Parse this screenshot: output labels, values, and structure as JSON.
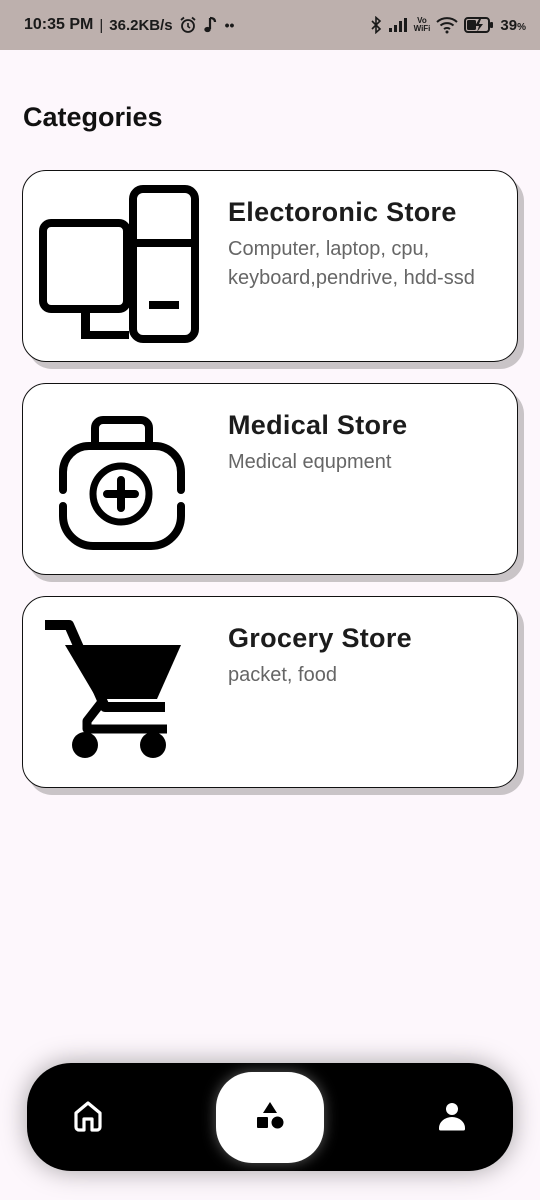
{
  "status_bar": {
    "time": "10:35 PM",
    "separator": "|",
    "network_speed": "36.2KB/s",
    "dots": "••",
    "volte_top": "Vo",
    "volte_bottom": "WiFi",
    "battery": "39",
    "battery_unit": "%",
    "icons": [
      "alarm-icon",
      "music-note-icon",
      "bluetooth-icon",
      "signal-icon",
      "wifi-icon",
      "battery-charging-icon"
    ]
  },
  "page": {
    "title": "Categories"
  },
  "categories": [
    {
      "icon": "computer-icon",
      "title": "Electoronic Store",
      "description": "Computer, laptop, cpu, keyboard,pendrive, hdd-ssd"
    },
    {
      "icon": "medical-kit-icon",
      "title": "Medical Store",
      "description": "Medical equpment"
    },
    {
      "icon": "shopping-cart-icon",
      "title": "Grocery Store",
      "description": "packet, food"
    }
  ],
  "bottom_nav": {
    "items": [
      {
        "icon": "home-icon",
        "active": false
      },
      {
        "icon": "shapes-icon",
        "active": true
      },
      {
        "icon": "profile-icon",
        "active": false
      }
    ]
  },
  "colors": {
    "status_bar": "#bdb0ad",
    "background": "#fdf7fc",
    "card_shadow": "#c9c4c7",
    "nav_background": "#000000"
  }
}
